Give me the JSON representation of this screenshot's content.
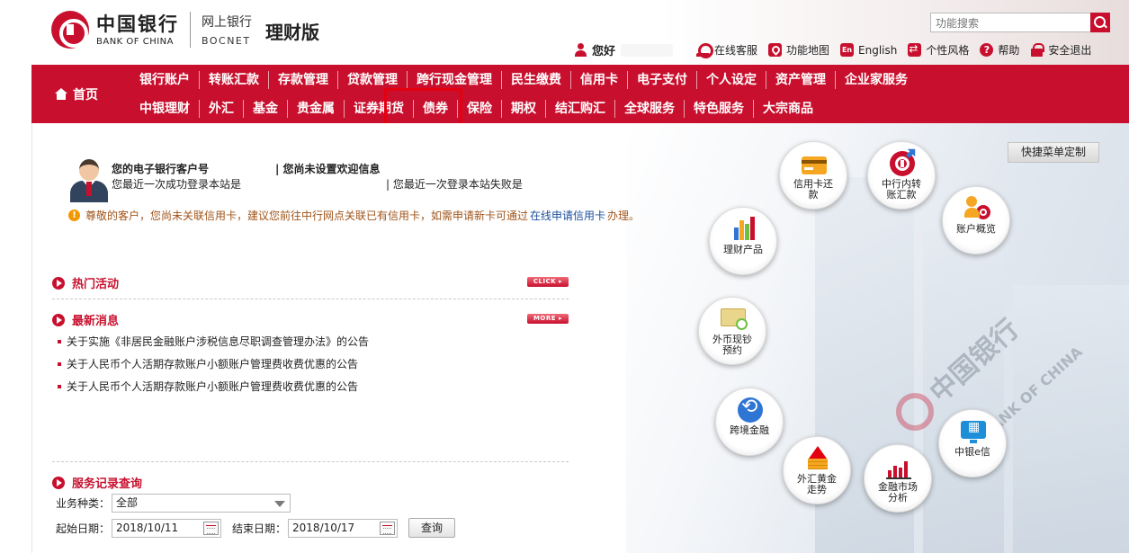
{
  "header": {
    "logo_cn": "中国银行",
    "logo_en": "BANK OF CHINA",
    "bocnet_cn": "网上银行",
    "bocnet_en": "BOCNET",
    "edition": "理财版",
    "search_placeholder": "功能搜索",
    "greeting": "您好",
    "links": [
      {
        "label": "在线客服",
        "icon": "customer-service-icon"
      },
      {
        "label": "功能地图",
        "icon": "map-pin-icon"
      },
      {
        "label": "English",
        "icon": "english-icon",
        "icon_text": "En"
      },
      {
        "label": "个性风格",
        "icon": "style-switch-icon"
      },
      {
        "label": "帮助",
        "icon": "help-icon",
        "icon_text": "?"
      },
      {
        "label": "安全退出",
        "icon": "lock-icon"
      }
    ]
  },
  "nav": {
    "home": "首页",
    "row1": [
      "银行账户",
      "转账汇款",
      "存款管理",
      "贷款管理",
      "跨行现金管理",
      "民生缴费",
      "信用卡",
      "电子支付",
      "个人设定",
      "资产管理",
      "企业家服务"
    ],
    "row2": [
      "中银理财",
      "外汇",
      "基金",
      "贵金属",
      "证券期货",
      "债券",
      "保险",
      "期权",
      "结汇购汇",
      "全球服务",
      "特色服务",
      "大宗商品"
    ]
  },
  "account": {
    "customer_no_label": "您的电子银行客户号",
    "welcome_label": "| 您尚未设置欢迎信息",
    "last_success": "您最近一次成功登录本站是",
    "last_fail": "| 您最近一次登录本站失败是",
    "notice_before": "尊敬的客户，您尚未关联信用卡，建议您前往中行网点关联已有信用卡，如需申请新卡可通过",
    "notice_link": "在线申请信用卡",
    "notice_after": "办理。"
  },
  "sections": {
    "hot": {
      "title": "热门活动",
      "tag": "CLICK ▸"
    },
    "news": {
      "title": "最新消息",
      "tag": "MORE ▸",
      "items": [
        "关于实施《非居民金融账户涉税信息尽职调查管理办法》的公告",
        "关于人民币个人活期存款账户小额账户管理费收费优惠的公告",
        "关于人民币个人活期存款账户小额账户管理费收费优惠的公告"
      ]
    },
    "service": {
      "title": "服务记录查询"
    }
  },
  "form": {
    "type_label": "业务种类：",
    "type_value": "全部",
    "start_label": "起始日期：",
    "start_value": "2018/10/11",
    "end_label": "结束日期：",
    "end_value": "2018/10/17",
    "query_label": "查询"
  },
  "quick_menu": {
    "customize_label": "快捷菜单定制",
    "items": [
      {
        "line1": "信用卡还",
        "line2": "款",
        "icon": "credit-card-icon"
      },
      {
        "line1": "中行内转",
        "line2": "账汇款",
        "icon": "boc-transfer-icon"
      },
      {
        "line1": "账户概览",
        "line2": "",
        "icon": "account-overview-icon"
      },
      {
        "line1": "理财产品",
        "line2": "",
        "icon": "wealth-product-icon"
      },
      {
        "line1": "外币现钞",
        "line2": "预约",
        "icon": "foreign-cash-icon"
      },
      {
        "line1": "跨境金融",
        "line2": "",
        "icon": "cross-border-icon"
      },
      {
        "line1": "中银e信",
        "line2": "",
        "icon": "boc-e-icon"
      },
      {
        "line1": "外汇黄金",
        "line2": "走势",
        "icon": "forex-gold-icon"
      },
      {
        "line1": "金融市场",
        "line2": "分析",
        "icon": "market-analysis-icon"
      }
    ]
  },
  "colors": {
    "brand_red": "#c8102e",
    "link_blue": "#1b4f9c",
    "notice_brown": "#a0541a"
  }
}
